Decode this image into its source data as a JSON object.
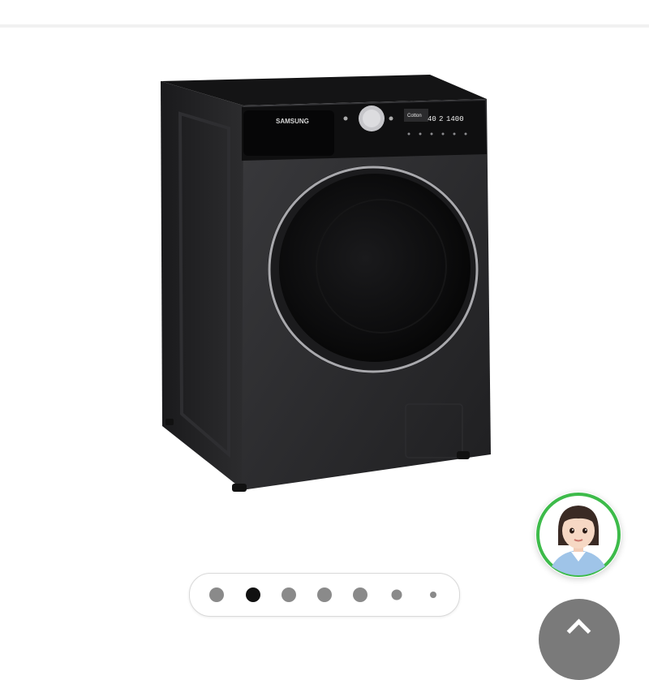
{
  "product": {
    "image_name": "front-load-washing-machine",
    "brand_logo_text": "SAMSUNG",
    "display": {
      "temperature": "40",
      "rinse": "2",
      "spin": "1400",
      "program": "Cotton"
    },
    "colors": {
      "body": "#2a2a2c",
      "door_ring": "#a9a9ad"
    }
  },
  "carousel": {
    "total": 7,
    "active_index": 1
  },
  "chat_widget": {
    "icon": "avatar-assistant-icon",
    "ring_color": "#3dbb4a"
  },
  "scroll_top": {
    "icon": "chevron-up-icon"
  }
}
